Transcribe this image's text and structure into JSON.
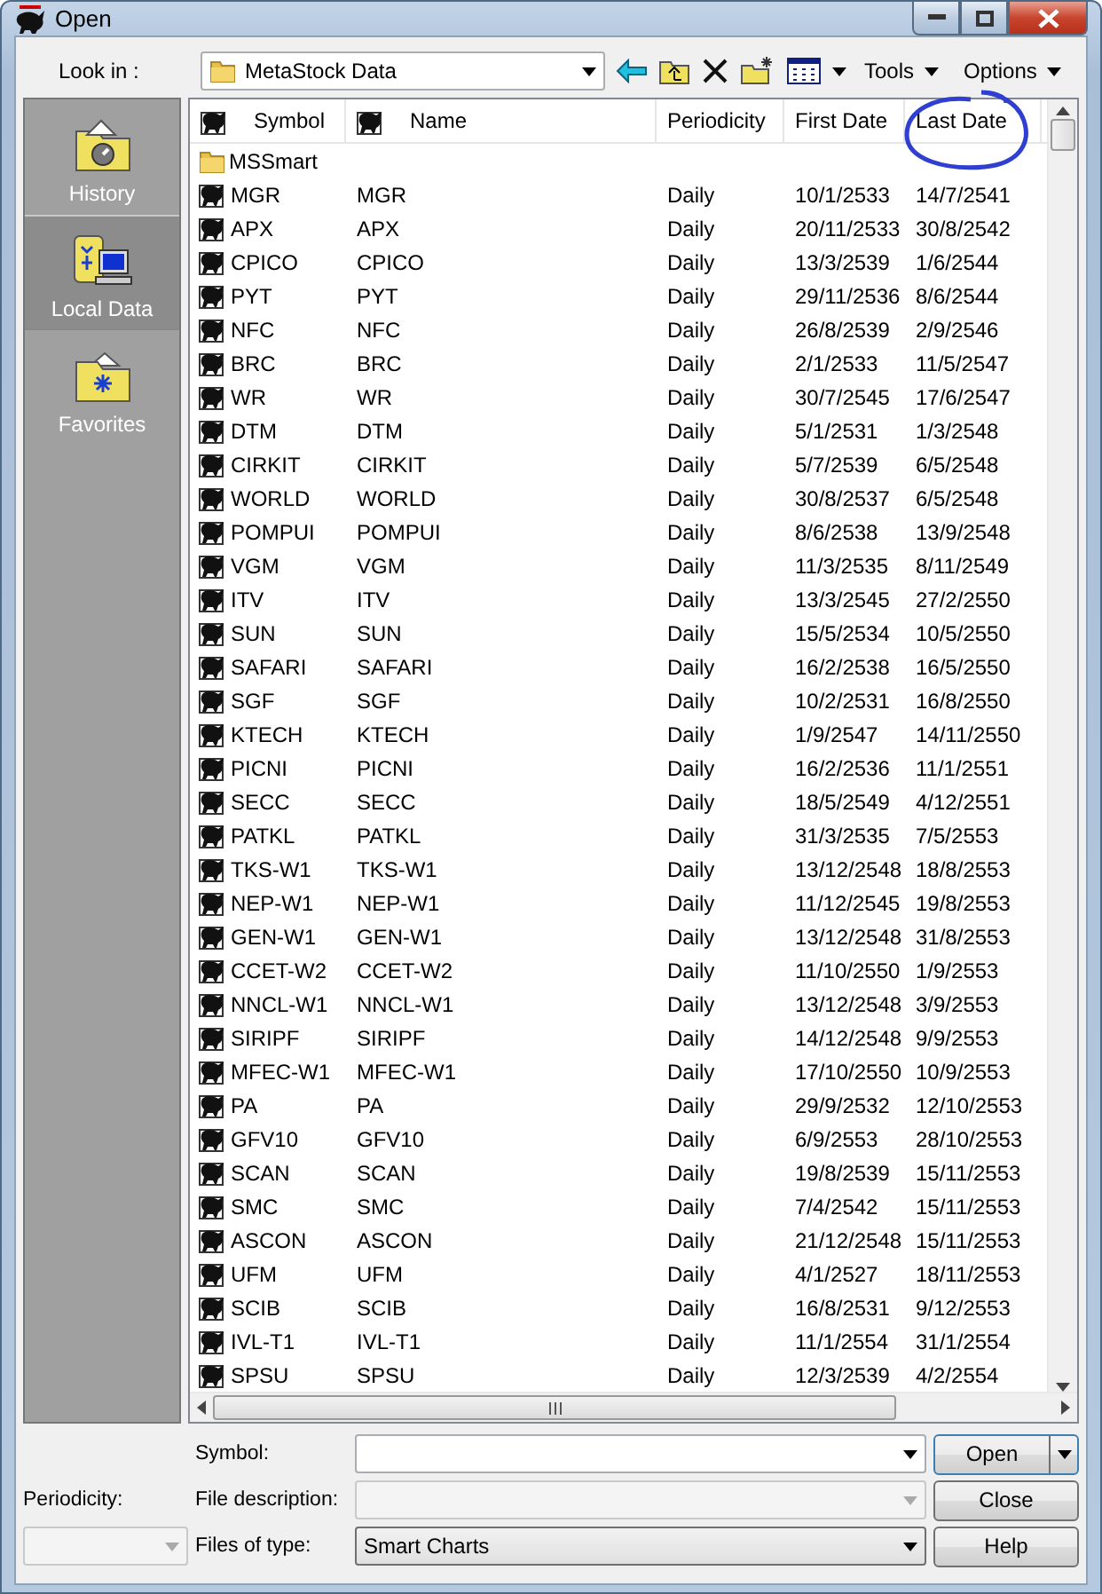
{
  "window": {
    "title": "Open"
  },
  "look_in": {
    "label": "Look in :",
    "value": "MetaStock Data"
  },
  "toolbar_menus": [
    "Tools",
    "Options"
  ],
  "sidebar": [
    {
      "label": "History",
      "kind": "history",
      "selected": false
    },
    {
      "label": "Local Data",
      "kind": "local",
      "selected": true
    },
    {
      "label": "Favorites",
      "kind": "favorites",
      "selected": false
    }
  ],
  "columns": [
    "Symbol",
    "Name",
    "Periodicity",
    "First Date",
    "Last Date"
  ],
  "folders": [
    "MSSmart"
  ],
  "rows": [
    {
      "symbol": "MGR",
      "name": "MGR",
      "periodicity": "Daily",
      "first": "10/1/2533",
      "last": "14/7/2541"
    },
    {
      "symbol": "APX",
      "name": "APX",
      "periodicity": "Daily",
      "first": "20/11/2533",
      "last": "30/8/2542"
    },
    {
      "symbol": "CPICO",
      "name": "CPICO",
      "periodicity": "Daily",
      "first": "13/3/2539",
      "last": "1/6/2544"
    },
    {
      "symbol": "PYT",
      "name": "PYT",
      "periodicity": "Daily",
      "first": "29/11/2536",
      "last": "8/6/2544"
    },
    {
      "symbol": "NFC",
      "name": "NFC",
      "periodicity": "Daily",
      "first": "26/8/2539",
      "last": "2/9/2546"
    },
    {
      "symbol": "BRC",
      "name": "BRC",
      "periodicity": "Daily",
      "first": "2/1/2533",
      "last": "11/5/2547"
    },
    {
      "symbol": "WR",
      "name": "WR",
      "periodicity": "Daily",
      "first": "30/7/2545",
      "last": "17/6/2547"
    },
    {
      "symbol": "DTM",
      "name": "DTM",
      "periodicity": "Daily",
      "first": "5/1/2531",
      "last": "1/3/2548"
    },
    {
      "symbol": "CIRKIT",
      "name": "CIRKIT",
      "periodicity": "Daily",
      "first": "5/7/2539",
      "last": "6/5/2548"
    },
    {
      "symbol": "WORLD",
      "name": "WORLD",
      "periodicity": "Daily",
      "first": "30/8/2537",
      "last": "6/5/2548"
    },
    {
      "symbol": "POMPUI",
      "name": "POMPUI",
      "periodicity": "Daily",
      "first": "8/6/2538",
      "last": "13/9/2548"
    },
    {
      "symbol": "VGM",
      "name": "VGM",
      "periodicity": "Daily",
      "first": "11/3/2535",
      "last": "8/11/2549"
    },
    {
      "symbol": "ITV",
      "name": "ITV",
      "periodicity": "Daily",
      "first": "13/3/2545",
      "last": "27/2/2550"
    },
    {
      "symbol": "SUN",
      "name": "SUN",
      "periodicity": "Daily",
      "first": "15/5/2534",
      "last": "10/5/2550"
    },
    {
      "symbol": "SAFARI",
      "name": "SAFARI",
      "periodicity": "Daily",
      "first": "16/2/2538",
      "last": "16/5/2550"
    },
    {
      "symbol": "SGF",
      "name": "SGF",
      "periodicity": "Daily",
      "first": "10/2/2531",
      "last": "16/8/2550"
    },
    {
      "symbol": "KTECH",
      "name": "KTECH",
      "periodicity": "Daily",
      "first": "1/9/2547",
      "last": "14/11/2550"
    },
    {
      "symbol": "PICNI",
      "name": "PICNI",
      "periodicity": "Daily",
      "first": "16/2/2536",
      "last": "11/1/2551"
    },
    {
      "symbol": "SECC",
      "name": "SECC",
      "periodicity": "Daily",
      "first": "18/5/2549",
      "last": "4/12/2551"
    },
    {
      "symbol": "PATKL",
      "name": "PATKL",
      "periodicity": "Daily",
      "first": "31/3/2535",
      "last": "7/5/2553"
    },
    {
      "symbol": "TKS-W1",
      "name": "TKS-W1",
      "periodicity": "Daily",
      "first": "13/12/2548",
      "last": "18/8/2553"
    },
    {
      "symbol": "NEP-W1",
      "name": "NEP-W1",
      "periodicity": "Daily",
      "first": "11/12/2545",
      "last": "19/8/2553"
    },
    {
      "symbol": "GEN-W1",
      "name": "GEN-W1",
      "periodicity": "Daily",
      "first": "13/12/2548",
      "last": "31/8/2553"
    },
    {
      "symbol": "CCET-W2",
      "name": "CCET-W2",
      "periodicity": "Daily",
      "first": "11/10/2550",
      "last": "1/9/2553"
    },
    {
      "symbol": "NNCL-W1",
      "name": "NNCL-W1",
      "periodicity": "Daily",
      "first": "13/12/2548",
      "last": "3/9/2553"
    },
    {
      "symbol": "SIRIPF",
      "name": "SIRIPF",
      "periodicity": "Daily",
      "first": "14/12/2548",
      "last": "9/9/2553"
    },
    {
      "symbol": "MFEC-W1",
      "name": "MFEC-W1",
      "periodicity": "Daily",
      "first": "17/10/2550",
      "last": "10/9/2553"
    },
    {
      "symbol": "PA",
      "name": "PA",
      "periodicity": "Daily",
      "first": "29/9/2532",
      "last": "12/10/2553"
    },
    {
      "symbol": "GFV10",
      "name": "GFV10",
      "periodicity": "Daily",
      "first": "6/9/2553",
      "last": "28/10/2553"
    },
    {
      "symbol": "SCAN",
      "name": "SCAN",
      "periodicity": "Daily",
      "first": "19/8/2539",
      "last": "15/11/2553"
    },
    {
      "symbol": "SMC",
      "name": "SMC",
      "periodicity": "Daily",
      "first": "7/4/2542",
      "last": "15/11/2553"
    },
    {
      "symbol": "ASCON",
      "name": "ASCON",
      "periodicity": "Daily",
      "first": "21/12/2548",
      "last": "15/11/2553"
    },
    {
      "symbol": "UFM",
      "name": "UFM",
      "periodicity": "Daily",
      "first": "4/1/2527",
      "last": "18/11/2553"
    },
    {
      "symbol": "SCIB",
      "name": "SCIB",
      "periodicity": "Daily",
      "first": "16/8/2531",
      "last": "9/12/2553"
    },
    {
      "symbol": "IVL-T1",
      "name": "IVL-T1",
      "periodicity": "Daily",
      "first": "11/1/2554",
      "last": "31/1/2554"
    },
    {
      "symbol": "SPSU",
      "name": "SPSU",
      "periodicity": "Daily",
      "first": "12/3/2539",
      "last": "4/2/2554"
    }
  ],
  "fields": [
    {
      "label": "Symbol:",
      "disabled": false
    },
    {
      "label": "File description:",
      "disabled": true
    },
    {
      "label": "Files of type:",
      "value": "Smart Charts",
      "disabled": false
    }
  ],
  "periodicity": {
    "label": "Periodicity:",
    "disabled": true
  },
  "buttons": [
    {
      "label": "Open",
      "kind": "split"
    },
    {
      "label": "Close",
      "kind": "plain"
    },
    {
      "label": "Help",
      "kind": "plain"
    }
  ]
}
